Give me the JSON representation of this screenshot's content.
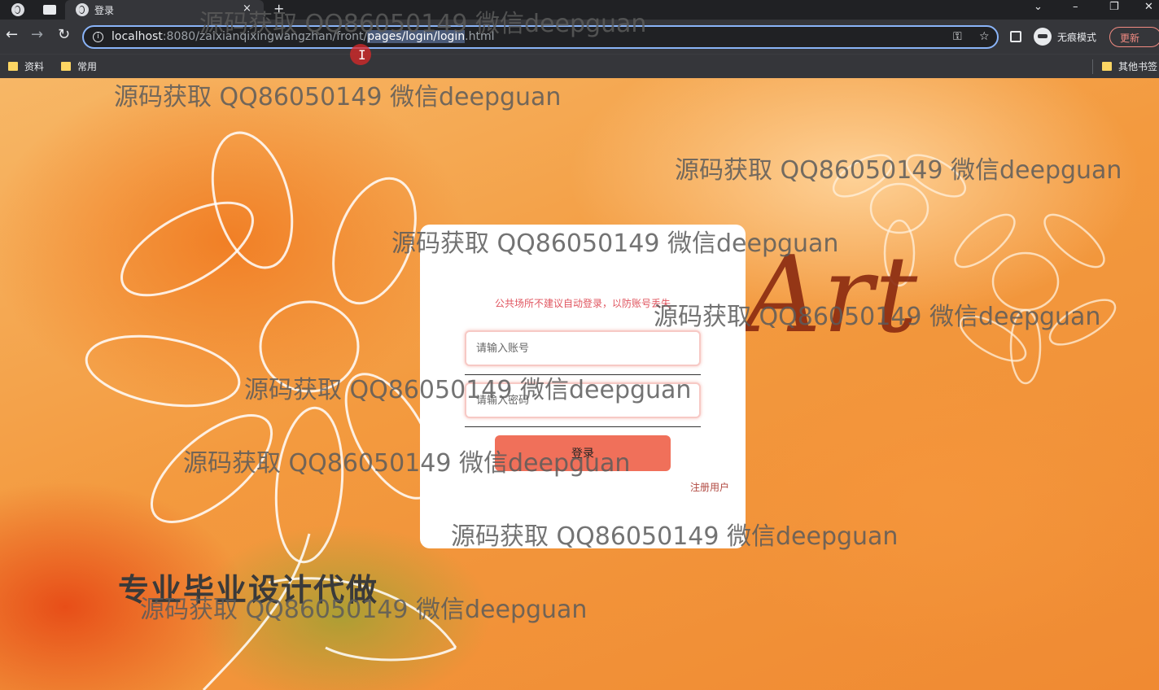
{
  "browser": {
    "tab_title": "登录",
    "tab_close": "×",
    "new_tab": "+",
    "url_host": "localhost",
    "url_port_path": ":8080/zaixianqixingwangzhan/front/",
    "url_selected": "pages/login/login",
    "url_tail": ".html",
    "incognito_label": "无痕模式",
    "update_label": "更新",
    "bookmarks": [
      "资料",
      "常用"
    ],
    "other_bookmarks": "其他书签"
  },
  "page": {
    "art_word": "Art",
    "banner": "专业毕业设计代做"
  },
  "login": {
    "tip": "公共场所不建议自动登录，以防账号丢失",
    "username_placeholder": "请输入账号",
    "password_placeholder": "请输入密码",
    "login_button": "登录",
    "register_link": "注册用户"
  },
  "watermark": "源码获取 QQ86050149 微信deepguan"
}
